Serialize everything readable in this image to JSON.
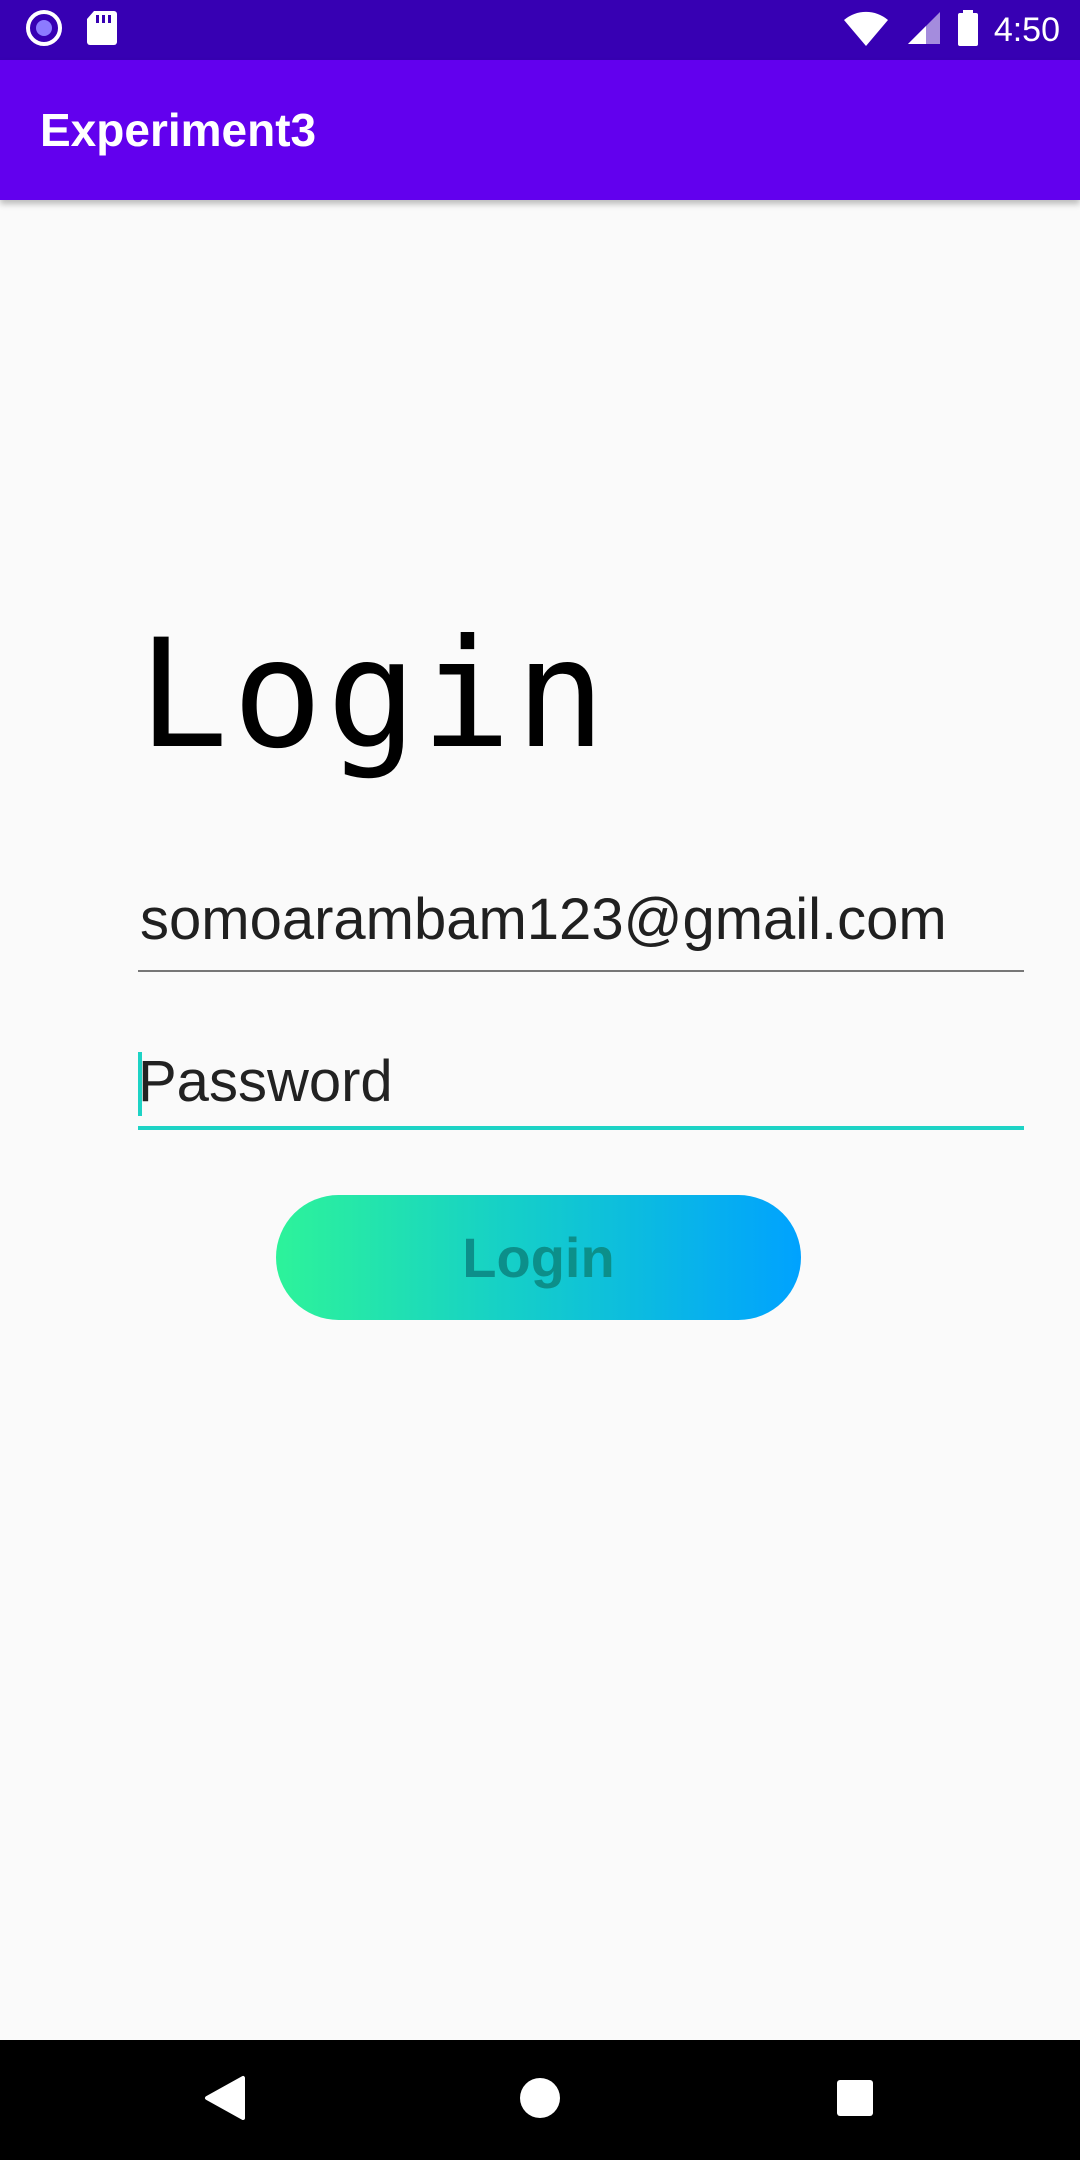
{
  "status_bar": {
    "time": "4:50",
    "icons": [
      "record-icon",
      "sd-card-icon",
      "wifi-icon",
      "signal-icon",
      "battery-icon"
    ]
  },
  "app_bar": {
    "title": "Experiment3"
  },
  "login_form": {
    "heading": "Login",
    "email_value": "somoarambam123@gmail.com",
    "password_placeholder": "Password",
    "login_button_label": "Login"
  },
  "nav_bar": {
    "icons": [
      "back-icon",
      "home-icon",
      "recents-icon"
    ]
  },
  "colors": {
    "status_bar": "#3700b3",
    "app_bar": "#6200ee",
    "accent": "#1dd3c5",
    "button_gradient_start": "#2df39a",
    "button_gradient_end": "#00a2ff"
  }
}
